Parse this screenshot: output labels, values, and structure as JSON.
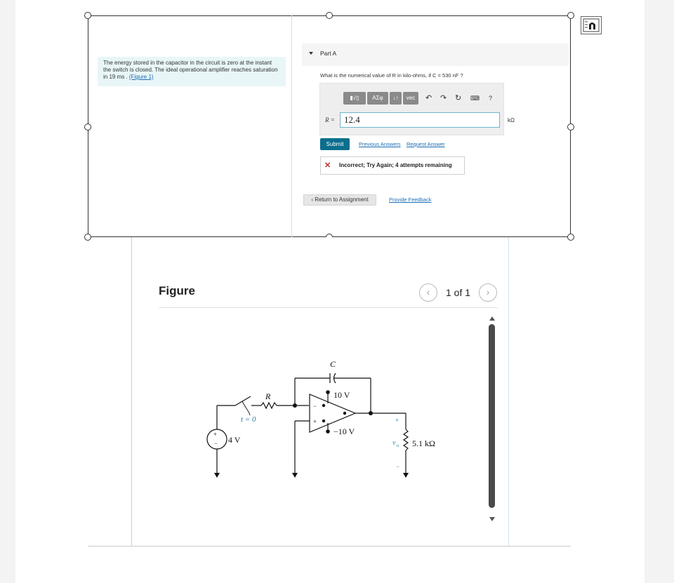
{
  "problem": {
    "intro_text": "The energy stored in the capacitor in the circuit is zero at the instant the switch is closed. The ideal operational amplifier reaches saturation in 19 ms . ",
    "figure_link": "(Figure 1)"
  },
  "part": {
    "label": "Part A",
    "question": "What is the numerical value of R in kilo-ohms, if C = 530 nF ?",
    "toolbar": {
      "template_label": "▮√▯",
      "greek_label": "ΑΣφ",
      "sort_label": "↓↑",
      "vec_label": "vec",
      "help_label": "?"
    },
    "answer_label": "R =",
    "answer_value": "12.4",
    "unit": "kΩ",
    "submit_label": "Submit",
    "previous_answers_label": "Previous Answers",
    "request_answer_label": "Request Answer",
    "feedback_text": "Incorrect; Try Again; 4 attempts remaining",
    "return_label": "Return to Assignment",
    "provide_feedback_label": "Provide Feedback"
  },
  "figure": {
    "title": "Figure",
    "pagination": "1 of 1",
    "circuit": {
      "capacitor_label": "C",
      "resistor_label": "R",
      "switch_label": "t = 0",
      "source_label": "4 V",
      "pos_rail": "10 V",
      "neg_rail": "−10 V",
      "output_label": "v",
      "output_sub": "o",
      "load_label": "5.1 kΩ",
      "plus": "+",
      "minus": "−"
    }
  },
  "colors": {
    "submit_bg": "#0a6e8c",
    "link": "#1a6db3",
    "error_x": "#c0302a",
    "intro_bg": "#e8f6f8",
    "input_border": "#6fb6c9"
  }
}
